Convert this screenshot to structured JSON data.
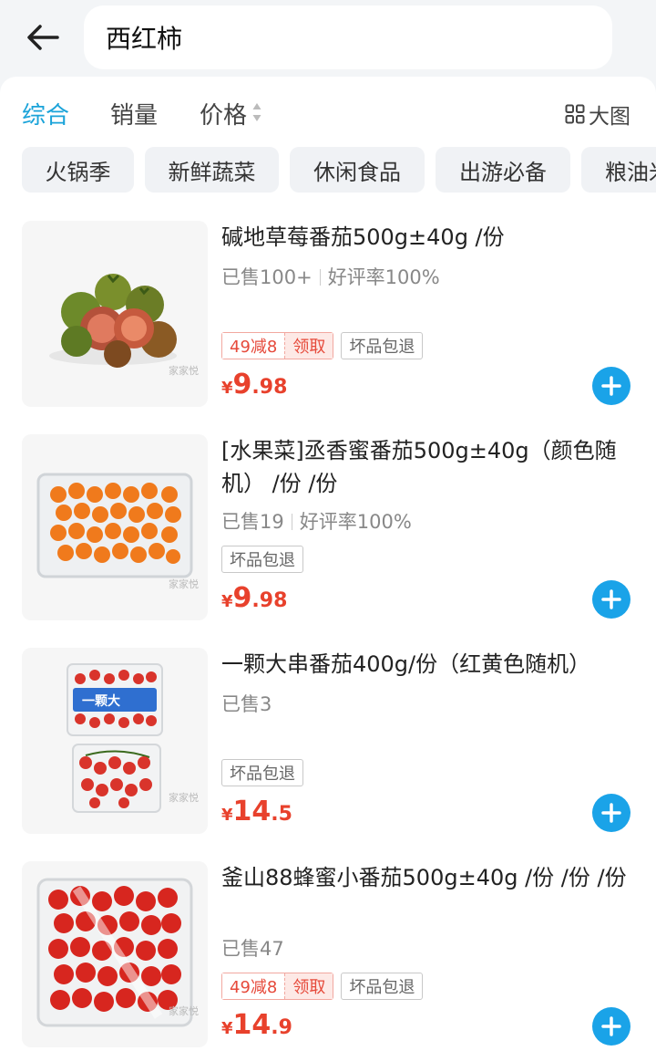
{
  "search": {
    "query": "西红柿"
  },
  "sort": {
    "tabs": [
      {
        "label": "综合",
        "active": true
      },
      {
        "label": "销量",
        "active": false
      },
      {
        "label": "价格",
        "active": false
      }
    ],
    "view_toggle": "大图"
  },
  "chips": [
    "火锅季",
    "新鲜蔬菜",
    "休闲食品",
    "出游必备",
    "粮油米面"
  ],
  "colors": {
    "accent": "#1aa3d9",
    "price": "#e8412c",
    "add_button": "#1aa3e8"
  },
  "products": [
    {
      "title": "碱地草莓番茄500g±40g /份",
      "sold": "已售100+",
      "rating": "好评率100%",
      "coupon": {
        "discount": "49减8",
        "action": "领取"
      },
      "return_tag": "坏品包退",
      "price": {
        "currency": "¥",
        "integer": "9",
        "decimal": ".98"
      },
      "watermark": "家家悦"
    },
    {
      "title": "[水果菜]丞香蜜番茄500g±40g（颜色随机） /份 /份",
      "sold": "已售19",
      "rating": "好评率100%",
      "return_tag": "坏品包退",
      "price": {
        "currency": "¥",
        "integer": "9",
        "decimal": ".98"
      },
      "watermark": "家家悦"
    },
    {
      "title": "一颗大串番茄400g/份（红黄色随机）",
      "sold": "已售3",
      "return_tag": "坏品包退",
      "price": {
        "currency": "¥",
        "integer": "14",
        "decimal": ".5"
      },
      "package_label": "一颗大",
      "watermark": "家家悦"
    },
    {
      "title": "釜山88蜂蜜小番茄500g±40g /份 /份 /份",
      "sold": "已售47",
      "coupon": {
        "discount": "49减8",
        "action": "领取"
      },
      "return_tag": "坏品包退",
      "price": {
        "currency": "¥",
        "integer": "14",
        "decimal": ".9"
      },
      "watermark": "家家悦"
    }
  ]
}
